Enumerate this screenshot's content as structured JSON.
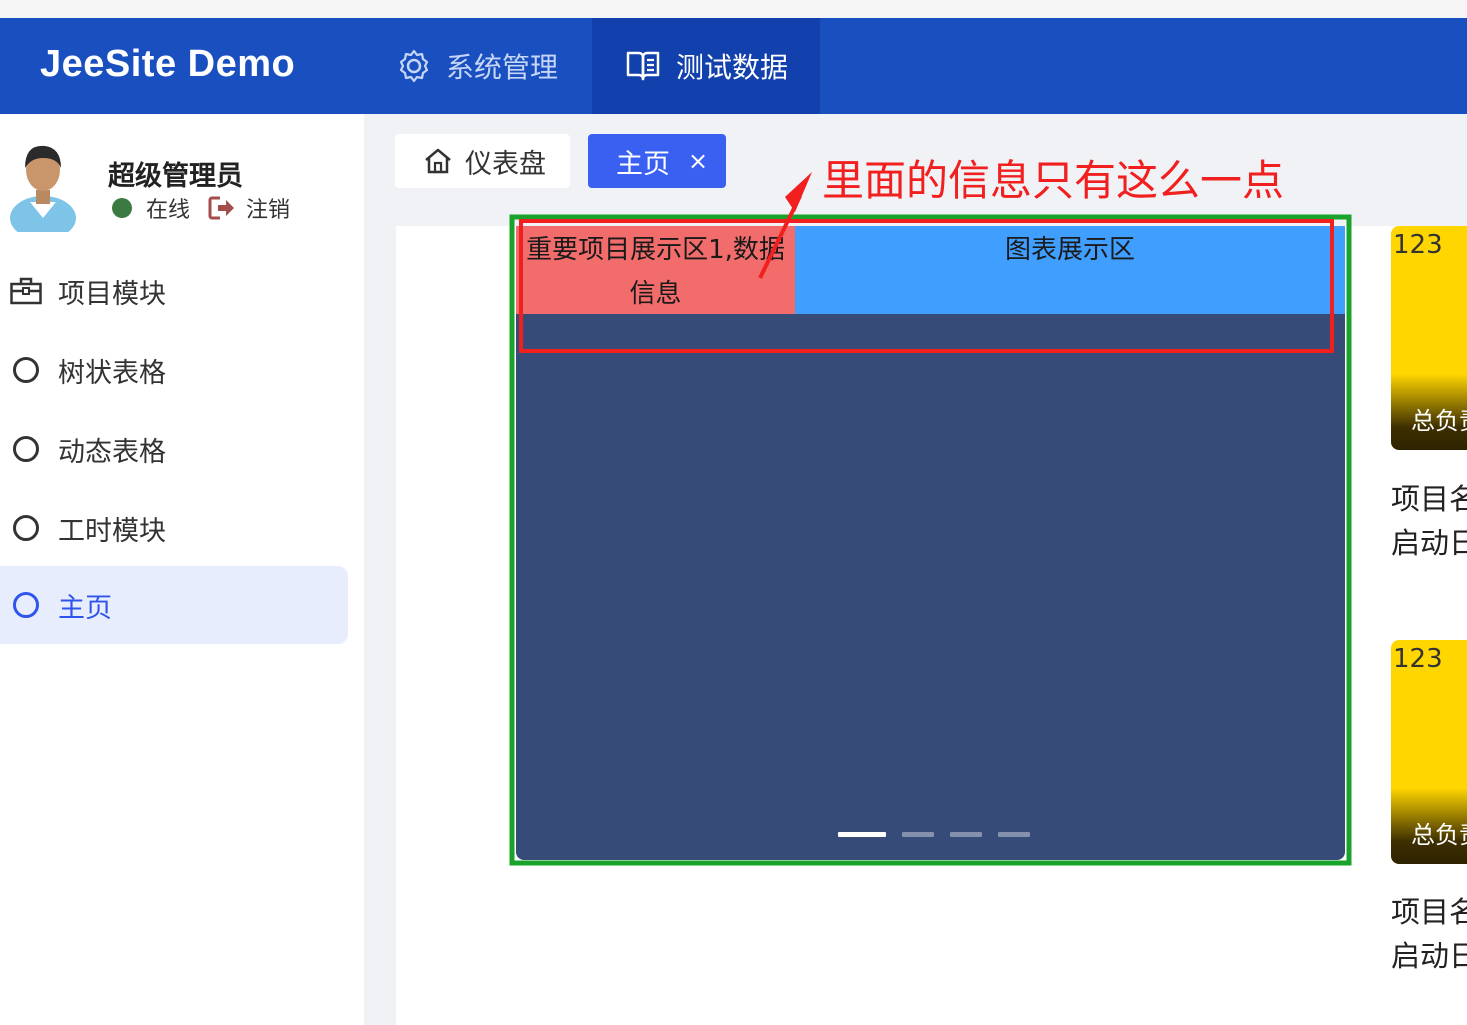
{
  "app": {
    "brand": "JeeSite Demo"
  },
  "topnav": [
    {
      "label": "系统管理",
      "icon": "gear-icon"
    },
    {
      "label": "测试数据",
      "icon": "book-icon"
    }
  ],
  "user": {
    "name": "超级管理员",
    "status": "在线",
    "logout": "注销"
  },
  "sidebar": {
    "items": [
      {
        "label": "项目模块",
        "icon": "briefcase-icon"
      },
      {
        "label": "树状表格",
        "icon": "circle-icon"
      },
      {
        "label": "动态表格",
        "icon": "circle-icon"
      },
      {
        "label": "工时模块",
        "icon": "circle-icon"
      },
      {
        "label": "主页",
        "icon": "circle-icon",
        "active": true
      }
    ]
  },
  "tabs": [
    {
      "label": "仪表盘",
      "icon": "home-icon"
    },
    {
      "label": "主页",
      "close": "×",
      "active": true
    }
  ],
  "annotation": {
    "text": "里面的信息只有这么一点"
  },
  "carousel": {
    "panel_left": "重要项目展示区1,数据信息",
    "panel_right": "图表展示区",
    "slides": 4,
    "active_slide": 1
  },
  "cards": [
    {
      "number": "123",
      "caption": "总负责",
      "line1": "项目名",
      "line2": "启动日"
    },
    {
      "number": "123",
      "caption": "总负责",
      "line1": "项目名",
      "line2": "启动日"
    }
  ],
  "colors": {
    "header": "#1a4fc0",
    "accent": "#2f54eb",
    "annotation": "#f21f1f",
    "frame": "#1aa32a",
    "carousel": "#364b78",
    "card": "#ffd600"
  }
}
